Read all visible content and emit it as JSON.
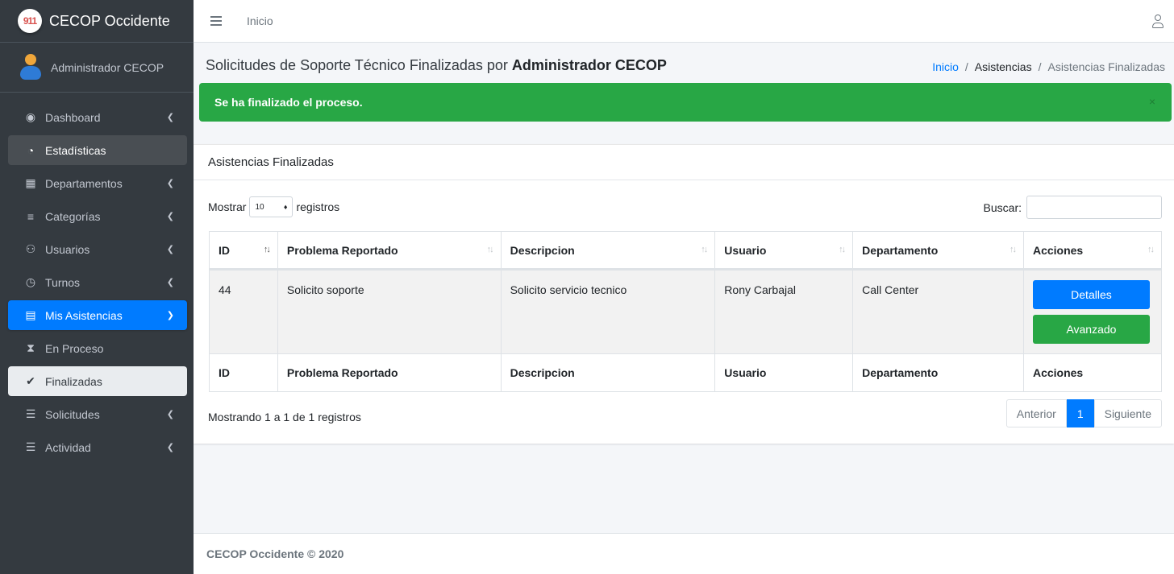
{
  "brand": {
    "name": "CECOP Occidente",
    "logo_text": "911"
  },
  "user": {
    "name": "Administrador CECOP"
  },
  "sidebar": {
    "items": [
      {
        "label": "Dashboard",
        "icon": "tachometer-icon",
        "glyph": "◉"
      },
      {
        "label": "Estadísticas",
        "icon": "pie-chart-icon",
        "glyph": "◔"
      },
      {
        "label": "Departamentos",
        "icon": "building-icon",
        "glyph": "▦"
      },
      {
        "label": "Categorías",
        "icon": "list-bars-icon",
        "glyph": "≡"
      },
      {
        "label": "Usuarios",
        "icon": "users-icon",
        "glyph": "⚇"
      },
      {
        "label": "Turnos",
        "icon": "clock-icon",
        "glyph": "◷"
      },
      {
        "label": "Mis Asistencias",
        "icon": "clipboard-icon",
        "glyph": "▤"
      },
      {
        "label": "En Proceso",
        "icon": "hourglass-icon",
        "glyph": "⧗"
      },
      {
        "label": "Finalizadas",
        "icon": "check-icon",
        "glyph": "✔"
      },
      {
        "label": "Solicitudes",
        "icon": "list-icon",
        "glyph": "☰"
      },
      {
        "label": "Actividad",
        "icon": "align-left-icon",
        "glyph": "☰"
      }
    ]
  },
  "header": {
    "home_link": "Inicio"
  },
  "page": {
    "title_prefix": "Solicitudes de Soporte Técnico Finalizadas por",
    "title_user": "Administrador CECOP",
    "breadcrumb": [
      "Inicio",
      "Asistencias",
      "Asistencias Finalizadas"
    ]
  },
  "alert": {
    "message": "Se ha finalizado el proceso.",
    "close": "×"
  },
  "card": {
    "title": "Asistencias Finalizadas",
    "show_label": "Mostrar",
    "page_size": "10",
    "records_label": "registros",
    "search_label": "Buscar:",
    "columns": [
      "ID",
      "Problema Reportado",
      "Descripcion",
      "Usuario",
      "Departamento",
      "Acciones"
    ],
    "rows": [
      {
        "id": "44",
        "problema": "Solicito soporte",
        "descripcion": "Solicito servicio tecnico",
        "usuario": "Rony Carbajal",
        "departamento": "Call Center",
        "details_btn": "Detalles",
        "advance_btn": "Avanzado"
      }
    ],
    "info": "Mostrando 1 a 1 de 1 registros",
    "pagination": {
      "prev": "Anterior",
      "current": "1",
      "next": "Siguiente"
    }
  },
  "footer": {
    "text": "CECOP Occidente © 2020"
  },
  "colors": {
    "primary": "#007bff",
    "success": "#28a745",
    "sidebar": "#343a40"
  }
}
